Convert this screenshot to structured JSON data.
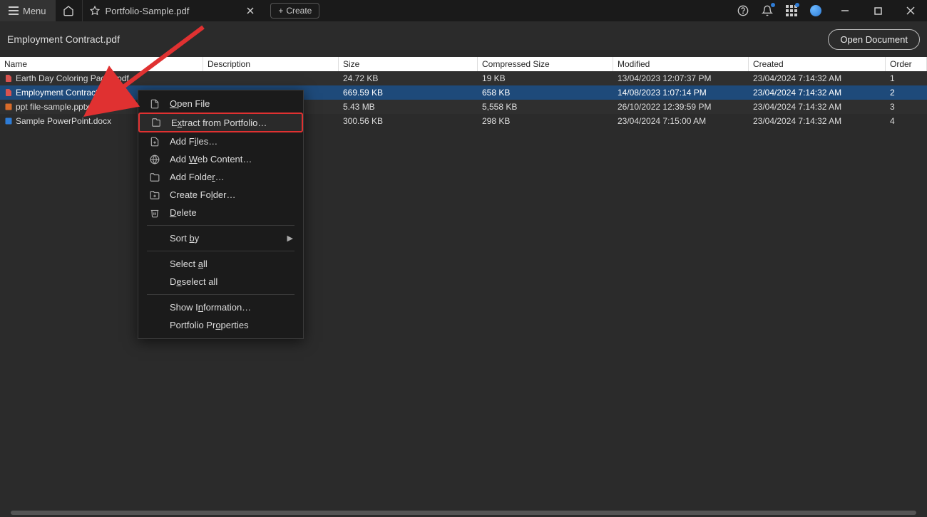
{
  "titlebar": {
    "menu": "Menu",
    "tab_title": "Portfolio-Sample.pdf",
    "create": "Create"
  },
  "subhead": {
    "doc_title": "Employment Contract.pdf",
    "open_doc": "Open Document"
  },
  "columns": {
    "name": "Name",
    "description": "Description",
    "size": "Size",
    "compressed": "Compressed Size",
    "modified": "Modified",
    "created": "Created",
    "order": "Order"
  },
  "rows": [
    {
      "icon": "pdf",
      "name": "Earth Day Coloring Pages.pdf",
      "desc": "",
      "size": "24.72 KB",
      "comp": "19 KB",
      "mod": "13/04/2023 12:07:37 PM",
      "created": "23/04/2024 7:14:32 AM",
      "order": "1"
    },
    {
      "icon": "pdf",
      "name": "Employment Contract.pdf",
      "desc": "",
      "size": "669.59 KB",
      "comp": "658 KB",
      "mod": "14/08/2023 1:07:14 PM",
      "created": "23/04/2024 7:14:32 AM",
      "order": "2",
      "selected": true
    },
    {
      "icon": "pptx",
      "name": "ppt file-sample.pptx",
      "desc": "",
      "size": "5.43 MB",
      "comp": "5,558 KB",
      "mod": "26/10/2022 12:39:59 PM",
      "created": "23/04/2024 7:14:32 AM",
      "order": "3"
    },
    {
      "icon": "docx",
      "name": "Sample PowerPoint.docx",
      "desc": "",
      "size": "300.56 KB",
      "comp": "298 KB",
      "mod": "23/04/2024 7:15:00 AM",
      "created": "23/04/2024 7:14:32 AM",
      "order": "4"
    }
  ],
  "context_menu": {
    "open_file": "Open File",
    "extract": "Extract from Portfolio…",
    "add_files": "Add Files…",
    "add_web": "Add Web Content…",
    "add_folder": "Add Folder…",
    "create_folder": "Create Folder…",
    "delete": "Delete",
    "sort_by": "Sort by",
    "select_all": "Select all",
    "deselect_all": "Deselect all",
    "show_info": "Show Information…",
    "properties": "Portfolio Properties"
  }
}
